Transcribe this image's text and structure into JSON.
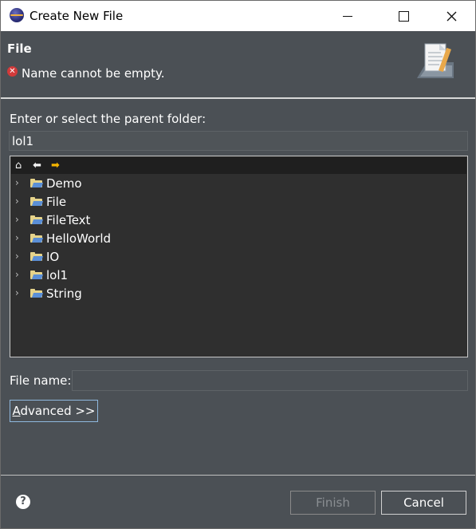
{
  "window": {
    "title": "Create New File",
    "app_icon": "eclipse-icon",
    "controls": [
      "minimize-icon",
      "maximize-icon",
      "close-icon"
    ]
  },
  "header": {
    "title": "File",
    "error_icon": "error-icon",
    "error_message": "Name cannot be empty."
  },
  "parent_folder": {
    "label": "Enter or select the parent folder:",
    "value": "lol1"
  },
  "tree": {
    "toolbar_icons": [
      "home-icon",
      "back-arrow-icon",
      "forward-arrow-icon"
    ],
    "items": [
      {
        "label": "Demo"
      },
      {
        "label": "File"
      },
      {
        "label": "FileText"
      },
      {
        "label": "HelloWorld"
      },
      {
        "label": "IO"
      },
      {
        "label": "lol1"
      },
      {
        "label": "String"
      }
    ]
  },
  "file_name": {
    "label": "File name:",
    "value": ""
  },
  "buttons": {
    "advanced_mnemonic": "A",
    "advanced_rest": "dvanced >>",
    "finish": "Finish",
    "cancel": "Cancel",
    "help_icon": "help-icon"
  },
  "colors": {
    "dialog_bg": "#4b5055",
    "tree_bg": "#2f2f2f",
    "error": "#d23a3a",
    "focus_border": "#8fb8de",
    "disabled_text": "#8a8e92"
  }
}
